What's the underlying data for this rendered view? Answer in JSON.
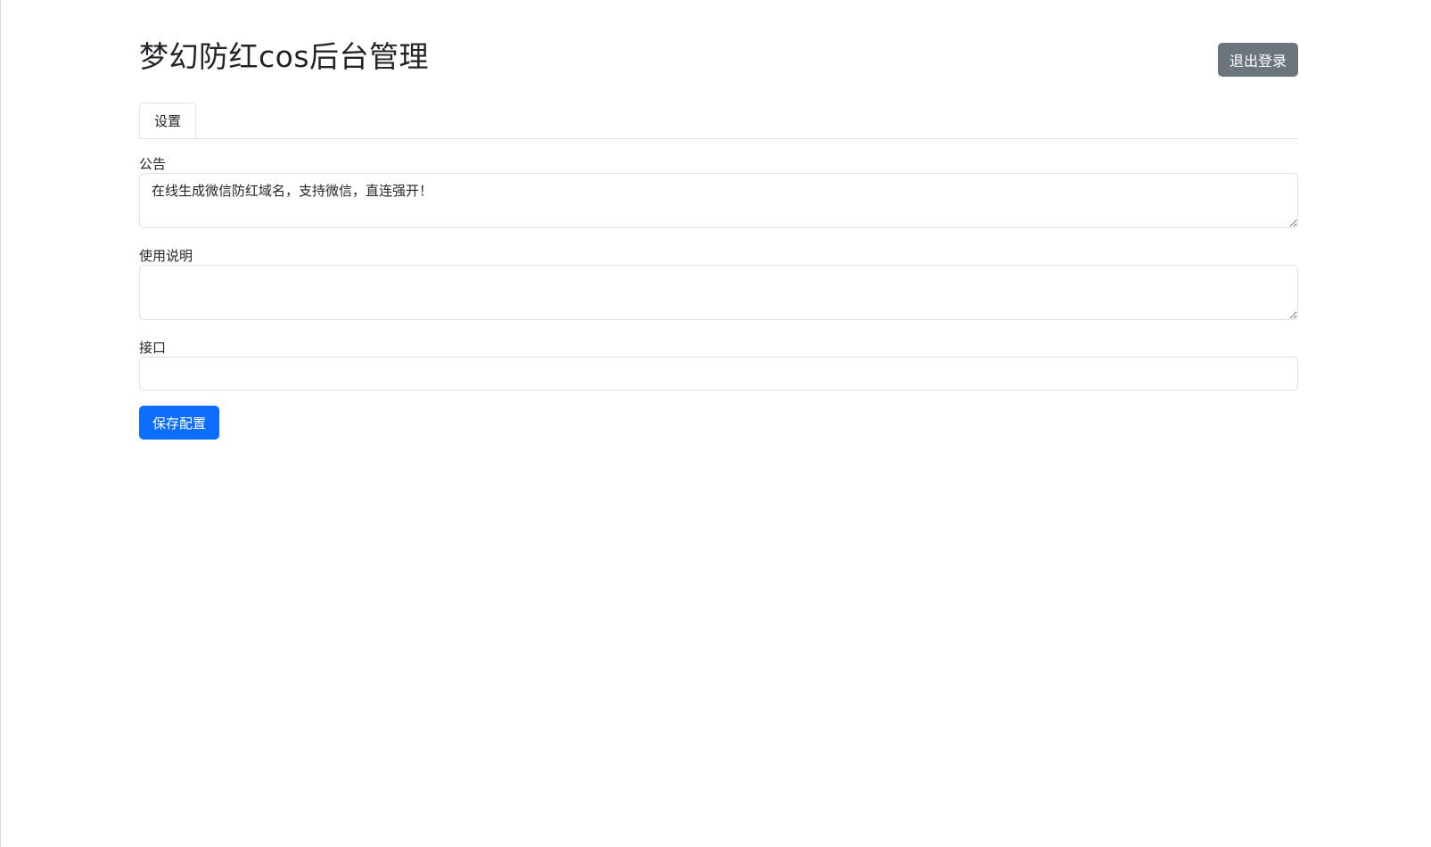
{
  "header": {
    "title": "梦幻防红cos后台管理",
    "logout_label": "退出登录"
  },
  "tabs": [
    {
      "label": "设置",
      "active": true
    }
  ],
  "form": {
    "notice": {
      "label": "公告",
      "value": "在线生成微信防红域名，支持微信，直连强开！"
    },
    "instructions": {
      "label": "使用说明",
      "value": ""
    },
    "api": {
      "label": "接口",
      "value": ""
    },
    "save_label": "保存配置"
  },
  "colors": {
    "primary": "#0d6efd",
    "secondary": "#6c757d",
    "border": "#dee2e6"
  }
}
